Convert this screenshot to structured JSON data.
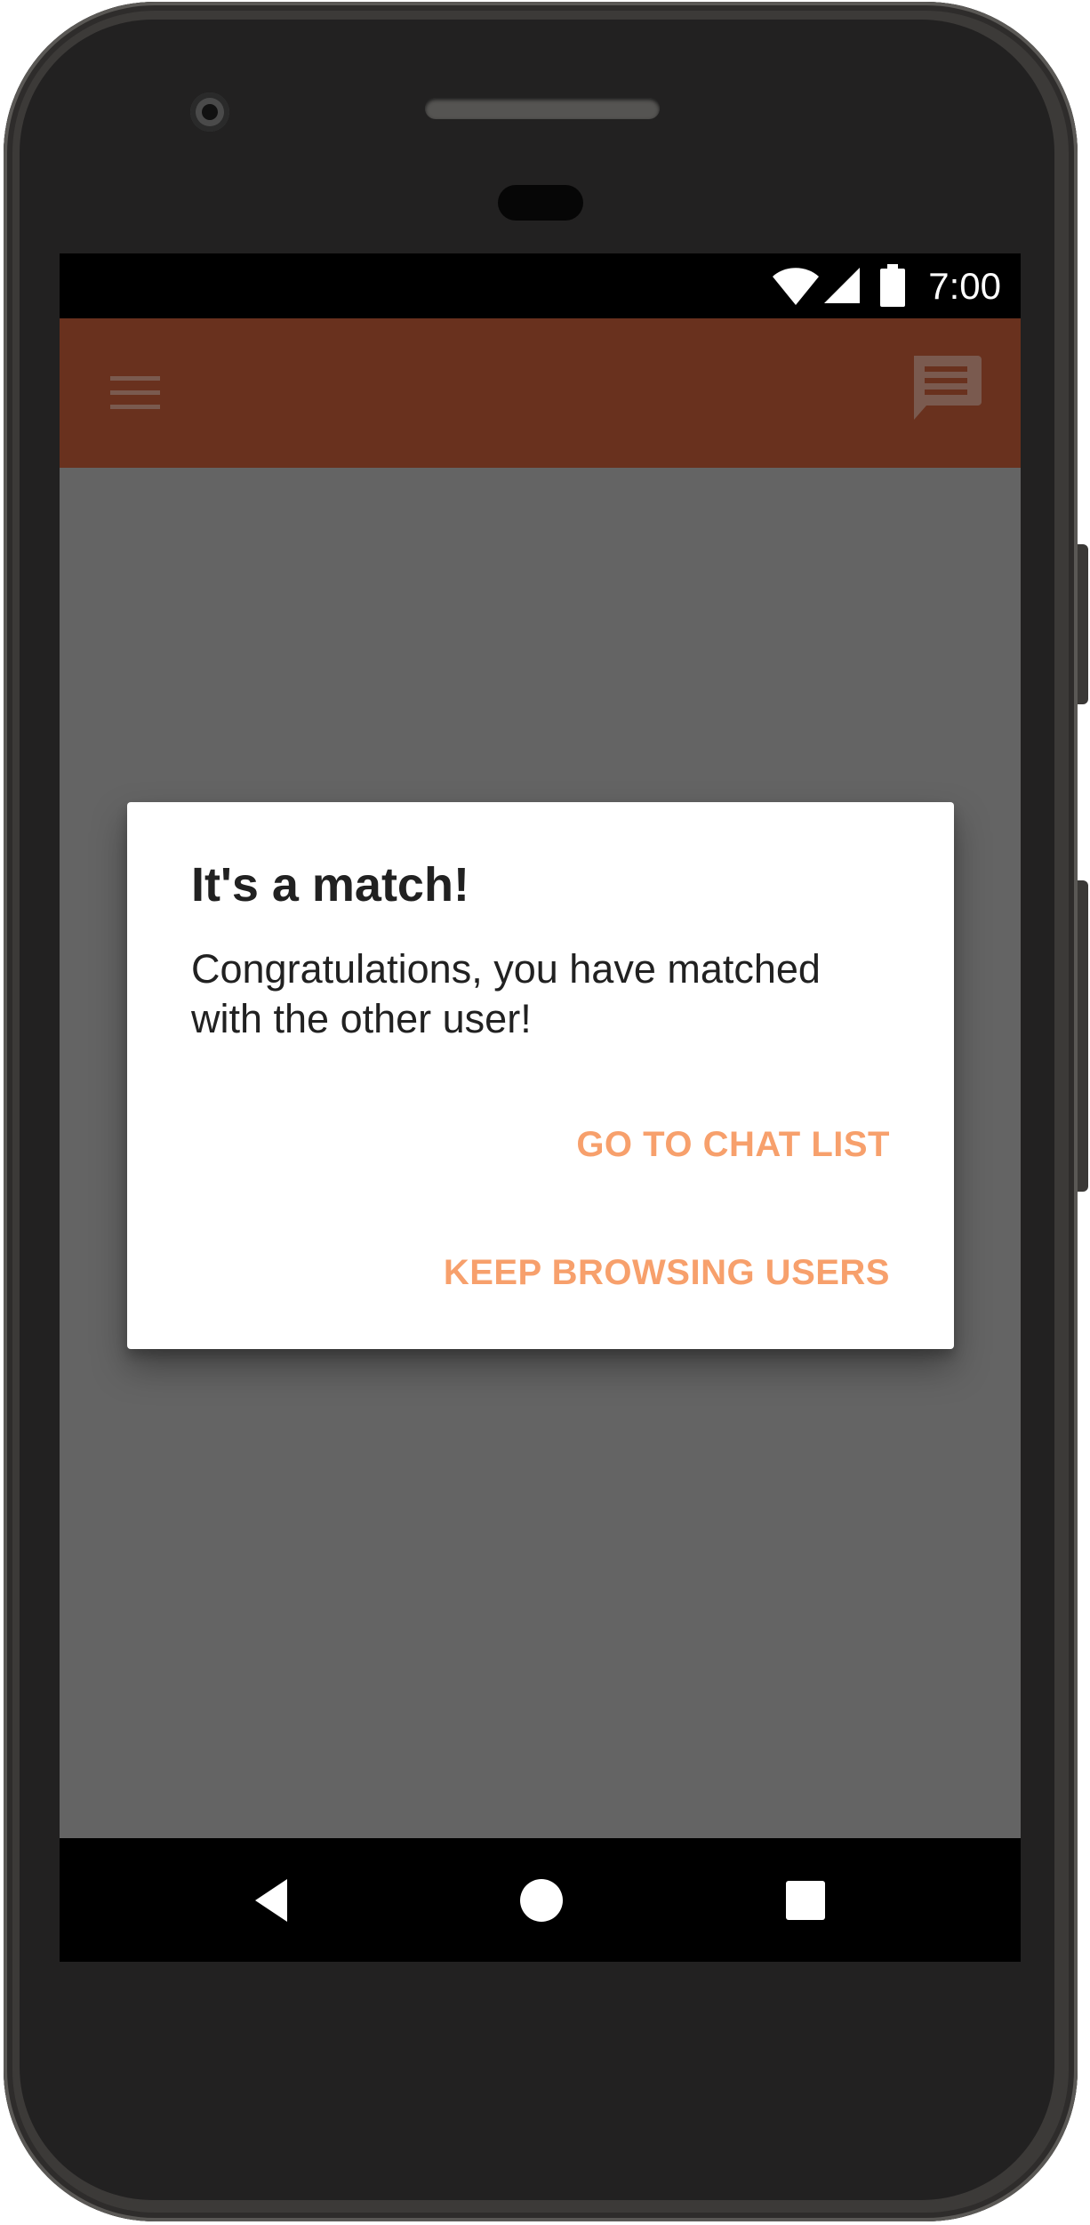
{
  "status_bar": {
    "time": "7:00",
    "icons": [
      "wifi-icon",
      "signal-icon",
      "battery-icon"
    ]
  },
  "app_bar": {
    "color": "#69311e",
    "left_icon": "menu-icon",
    "right_icon": "chat-icon"
  },
  "dialog": {
    "title": "It's a match!",
    "message": "Congratulations, you have matched with the other user!",
    "buttons": {
      "chat_list": "GO TO CHAT LIST",
      "keep_browsing": "KEEP BROWSING USERS"
    },
    "accent_color": "#f7a06c"
  },
  "nav_bar": {
    "icons": [
      "back-icon",
      "home-icon",
      "recents-icon"
    ]
  },
  "colors": {
    "scrim": "#646464",
    "app_bar": "#69311e",
    "dialog_bg": "#ffffff",
    "text": "#212121",
    "button_text": "#f7a06c"
  }
}
